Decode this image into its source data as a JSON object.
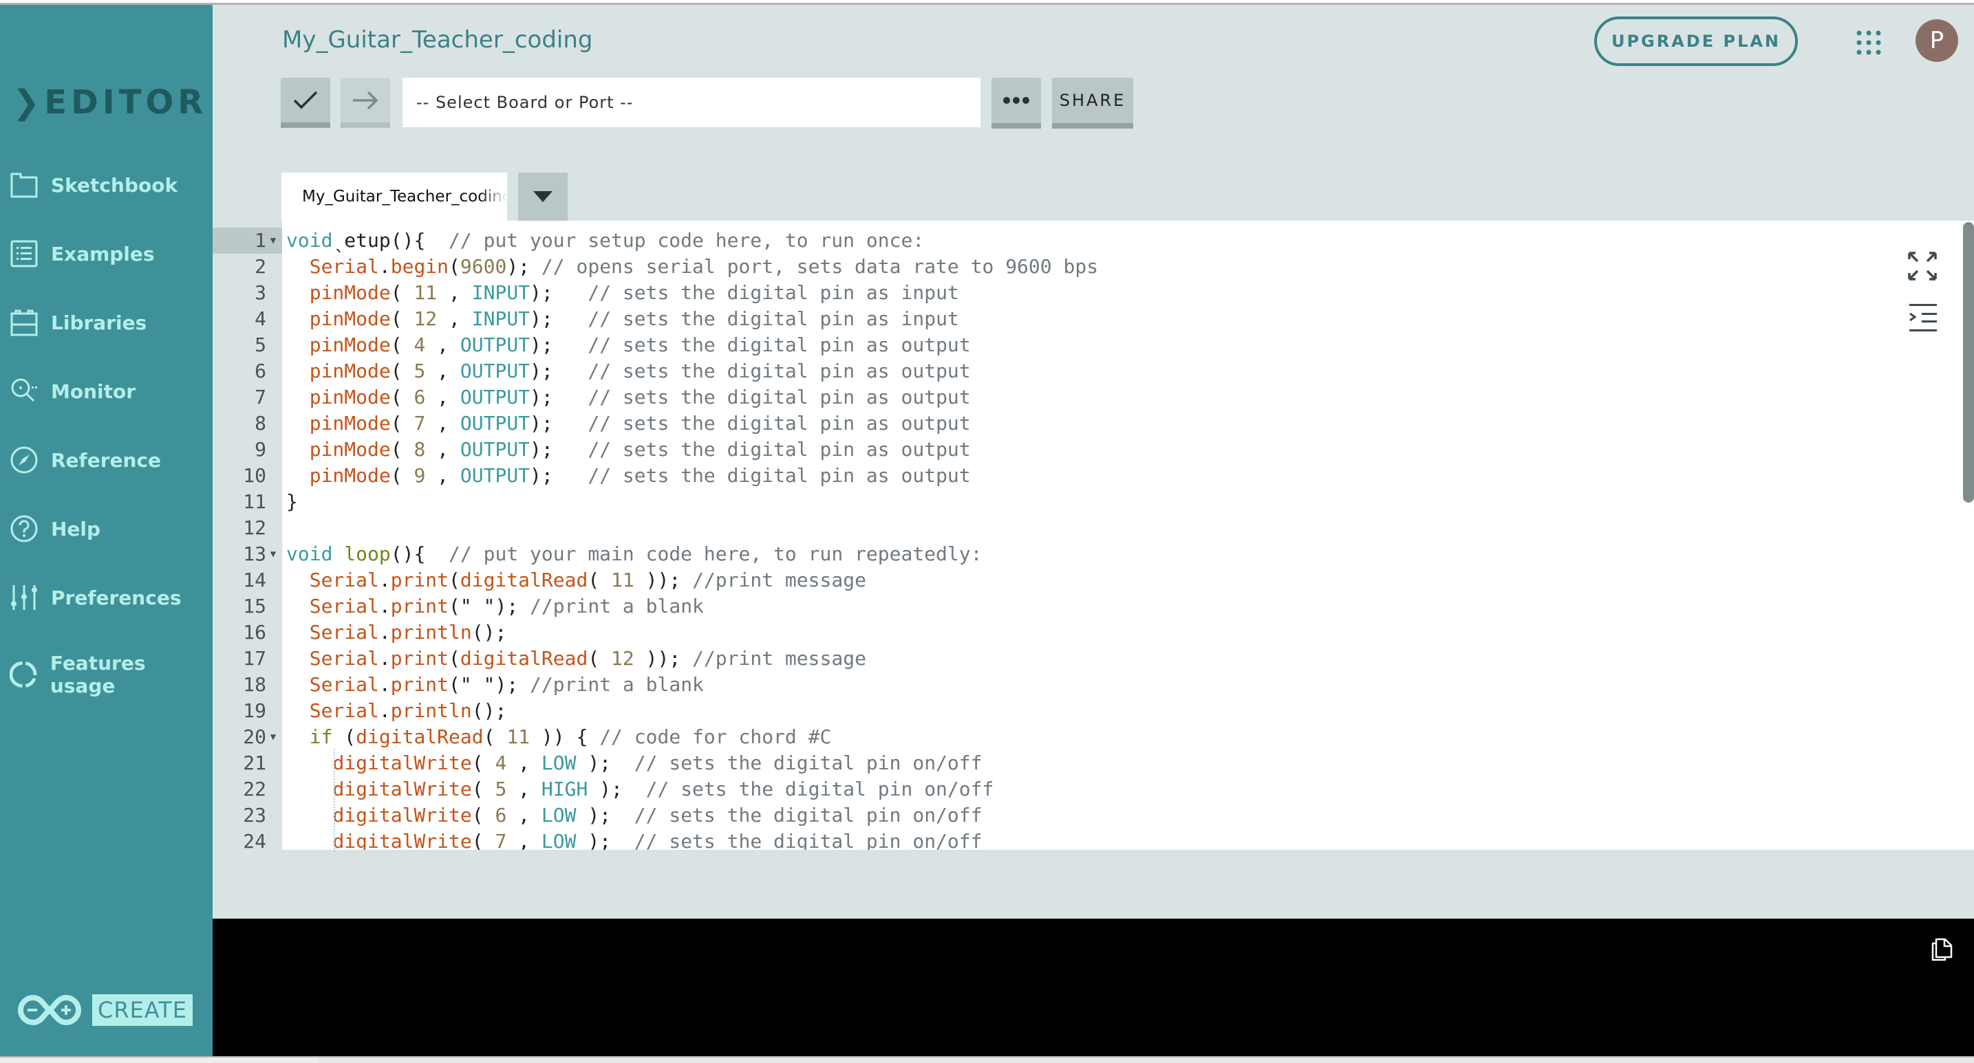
{
  "sidebar": {
    "brand": ">EDITOR",
    "brand_word": "EDITOR",
    "items": [
      {
        "label": "Sketchbook",
        "icon": "folder-icon"
      },
      {
        "label": "Examples",
        "icon": "list-icon"
      },
      {
        "label": "Libraries",
        "icon": "library-icon"
      },
      {
        "label": "Monitor",
        "icon": "monitor-icon"
      },
      {
        "label": "Reference",
        "icon": "compass-icon"
      },
      {
        "label": "Help",
        "icon": "help-icon"
      },
      {
        "label": "Preferences",
        "icon": "sliders-icon"
      },
      {
        "label": "Features usage",
        "icon": "usage-icon"
      }
    ],
    "footer_logo_text": "CREATE"
  },
  "header": {
    "sketch_title": "My_Guitar_Teacher_coding",
    "board_select_placeholder": "-- Select Board or Port --",
    "share_label": "SHARE",
    "more_label": "•••",
    "upgrade_label": "UPGRADE PLAN",
    "avatar_initial": "P"
  },
  "tabs": [
    {
      "label": "My_Guitar_Teacher_coding",
      "active": true
    }
  ],
  "colors": {
    "sidebar_bg": "#3f9199",
    "sidebar_text": "#b3eeea",
    "accent": "#3a8288",
    "avatar_bg": "#8a6e66",
    "console_bg": "#000000"
  },
  "editor": {
    "active_line": 1,
    "lines": [
      {
        "n": "1",
        "fold": true,
        "tokens": [
          [
            "kw",
            "void"
          ],
          [
            "",
            "ˎ"
          ],
          [
            "",
            "etup(){  "
          ],
          [
            "cm",
            "// put your setup code here, to run once:"
          ]
        ]
      },
      {
        "n": "2",
        "tokens": [
          [
            "",
            "  "
          ],
          [
            "fn",
            "Serial"
          ],
          [
            "",
            "."
          ],
          [
            "fn",
            "begin"
          ],
          [
            "",
            "("
          ],
          [
            "num",
            "9600"
          ],
          [
            "",
            "); "
          ],
          [
            "cm",
            "// opens serial port, sets data rate to 9600 bps"
          ]
        ]
      },
      {
        "n": "3",
        "tokens": [
          [
            "",
            "  "
          ],
          [
            "fn",
            "pinMode"
          ],
          [
            "",
            "( "
          ],
          [
            "num",
            "11"
          ],
          [
            "",
            " , "
          ],
          [
            "const",
            "INPUT"
          ],
          [
            "",
            ");   "
          ],
          [
            "cm",
            "// sets the digital pin as input"
          ]
        ]
      },
      {
        "n": "4",
        "tokens": [
          [
            "",
            "  "
          ],
          [
            "fn",
            "pinMode"
          ],
          [
            "",
            "( "
          ],
          [
            "num",
            "12"
          ],
          [
            "",
            " , "
          ],
          [
            "const",
            "INPUT"
          ],
          [
            "",
            ");   "
          ],
          [
            "cm",
            "// sets the digital pin as input"
          ]
        ]
      },
      {
        "n": "5",
        "tokens": [
          [
            "",
            "  "
          ],
          [
            "fn",
            "pinMode"
          ],
          [
            "",
            "( "
          ],
          [
            "num",
            "4"
          ],
          [
            "",
            " , "
          ],
          [
            "const",
            "OUTPUT"
          ],
          [
            "",
            ");   "
          ],
          [
            "cm",
            "// sets the digital pin as output"
          ]
        ]
      },
      {
        "n": "6",
        "tokens": [
          [
            "",
            "  "
          ],
          [
            "fn",
            "pinMode"
          ],
          [
            "",
            "( "
          ],
          [
            "num",
            "5"
          ],
          [
            "",
            " , "
          ],
          [
            "const",
            "OUTPUT"
          ],
          [
            "",
            ");   "
          ],
          [
            "cm",
            "// sets the digital pin as output"
          ]
        ]
      },
      {
        "n": "7",
        "tokens": [
          [
            "",
            "  "
          ],
          [
            "fn",
            "pinMode"
          ],
          [
            "",
            "( "
          ],
          [
            "num",
            "6"
          ],
          [
            "",
            " , "
          ],
          [
            "const",
            "OUTPUT"
          ],
          [
            "",
            ");   "
          ],
          [
            "cm",
            "// sets the digital pin as output"
          ]
        ]
      },
      {
        "n": "8",
        "tokens": [
          [
            "",
            "  "
          ],
          [
            "fn",
            "pinMode"
          ],
          [
            "",
            "( "
          ],
          [
            "num",
            "7"
          ],
          [
            "",
            " , "
          ],
          [
            "const",
            "OUTPUT"
          ],
          [
            "",
            ");   "
          ],
          [
            "cm",
            "// sets the digital pin as output"
          ]
        ]
      },
      {
        "n": "9",
        "tokens": [
          [
            "",
            "  "
          ],
          [
            "fn",
            "pinMode"
          ],
          [
            "",
            "( "
          ],
          [
            "num",
            "8"
          ],
          [
            "",
            " , "
          ],
          [
            "const",
            "OUTPUT"
          ],
          [
            "",
            ");   "
          ],
          [
            "cm",
            "// sets the digital pin as output"
          ]
        ]
      },
      {
        "n": "10",
        "tokens": [
          [
            "",
            "  "
          ],
          [
            "fn",
            "pinMode"
          ],
          [
            "",
            "( "
          ],
          [
            "num",
            "9"
          ],
          [
            "",
            " , "
          ],
          [
            "const",
            "OUTPUT"
          ],
          [
            "",
            ");   "
          ],
          [
            "cm",
            "// sets the digital pin as output"
          ]
        ]
      },
      {
        "n": "11",
        "tokens": [
          [
            "",
            "}"
          ]
        ]
      },
      {
        "n": "12",
        "tokens": []
      },
      {
        "n": "13",
        "fold": true,
        "tokens": [
          [
            "kw",
            "void"
          ],
          [
            "",
            " "
          ],
          [
            "ctl",
            "loop"
          ],
          [
            "",
            "(){  "
          ],
          [
            "cm",
            "// put your main code here, to run repeatedly:"
          ]
        ]
      },
      {
        "n": "14",
        "tokens": [
          [
            "",
            "  "
          ],
          [
            "fn",
            "Serial"
          ],
          [
            "",
            "."
          ],
          [
            "fn",
            "print"
          ],
          [
            "",
            "("
          ],
          [
            "fn",
            "digitalRead"
          ],
          [
            "",
            "( "
          ],
          [
            "num",
            "11"
          ],
          [
            "",
            " )); "
          ],
          [
            "cm",
            "//print message"
          ]
        ]
      },
      {
        "n": "15",
        "tokens": [
          [
            "",
            "  "
          ],
          [
            "fn",
            "Serial"
          ],
          [
            "",
            "."
          ],
          [
            "fn",
            "print"
          ],
          [
            "",
            "(\" \"); "
          ],
          [
            "cm",
            "//print a blank"
          ]
        ]
      },
      {
        "n": "16",
        "tokens": [
          [
            "",
            "  "
          ],
          [
            "fn",
            "Serial"
          ],
          [
            "",
            "."
          ],
          [
            "fn",
            "println"
          ],
          [
            "",
            "();"
          ]
        ]
      },
      {
        "n": "17",
        "tokens": [
          [
            "",
            "  "
          ],
          [
            "fn",
            "Serial"
          ],
          [
            "",
            "."
          ],
          [
            "fn",
            "print"
          ],
          [
            "",
            "("
          ],
          [
            "fn",
            "digitalRead"
          ],
          [
            "",
            "( "
          ],
          [
            "num",
            "12"
          ],
          [
            "",
            " )); "
          ],
          [
            "cm",
            "//print message"
          ]
        ]
      },
      {
        "n": "18",
        "tokens": [
          [
            "",
            "  "
          ],
          [
            "fn",
            "Serial"
          ],
          [
            "",
            "."
          ],
          [
            "fn",
            "print"
          ],
          [
            "",
            "(\" \"); "
          ],
          [
            "cm",
            "//print a blank"
          ]
        ]
      },
      {
        "n": "19",
        "tokens": [
          [
            "",
            "  "
          ],
          [
            "fn",
            "Serial"
          ],
          [
            "",
            "."
          ],
          [
            "fn",
            "println"
          ],
          [
            "",
            "();"
          ]
        ]
      },
      {
        "n": "20",
        "fold": true,
        "tokens": [
          [
            "",
            "  "
          ],
          [
            "ctl",
            "if"
          ],
          [
            "",
            " ("
          ],
          [
            "fn",
            "digitalRead"
          ],
          [
            "",
            "( "
          ],
          [
            "num",
            "11"
          ],
          [
            "",
            " )) { "
          ],
          [
            "cm",
            "// code for chord #C"
          ]
        ]
      },
      {
        "n": "21",
        "tokens": [
          [
            "",
            "    "
          ],
          [
            "fn",
            "digitalWrite"
          ],
          [
            "",
            "( "
          ],
          [
            "num",
            "4"
          ],
          [
            "",
            " , "
          ],
          [
            "const",
            "LOW"
          ],
          [
            "",
            " );  "
          ],
          [
            "cm",
            "// sets the digital pin on/off"
          ]
        ]
      },
      {
        "n": "22",
        "tokens": [
          [
            "",
            "    "
          ],
          [
            "fn",
            "digitalWrite"
          ],
          [
            "",
            "( "
          ],
          [
            "num",
            "5"
          ],
          [
            "",
            " , "
          ],
          [
            "const",
            "HIGH"
          ],
          [
            "",
            " );  "
          ],
          [
            "cm",
            "// sets the digital pin on/off"
          ]
        ]
      },
      {
        "n": "23",
        "tokens": [
          [
            "",
            "    "
          ],
          [
            "fn",
            "digitalWrite"
          ],
          [
            "",
            "( "
          ],
          [
            "num",
            "6"
          ],
          [
            "",
            " , "
          ],
          [
            "const",
            "LOW"
          ],
          [
            "",
            " );  "
          ],
          [
            "cm",
            "// sets the digital pin on/off"
          ]
        ]
      },
      {
        "n": "24",
        "tokens": [
          [
            "",
            "    "
          ],
          [
            "fn",
            "digitalWrite"
          ],
          [
            "",
            "( "
          ],
          [
            "num",
            "7"
          ],
          [
            "",
            " , "
          ],
          [
            "const",
            "LOW"
          ],
          [
            "",
            " );  "
          ],
          [
            "cm",
            "// sets the digital pin on/off"
          ]
        ]
      }
    ]
  },
  "console": {
    "output": ""
  }
}
